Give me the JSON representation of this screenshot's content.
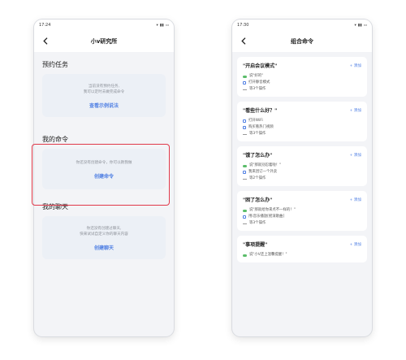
{
  "left": {
    "status_time": "17:24",
    "title": "小v研究所",
    "sections": [
      {
        "title": "预约任务",
        "lines": [
          "当前没有预约任务,",
          "我可以定时去做完成命令"
        ],
        "link": "查看示例说法"
      },
      {
        "title": "我的命令",
        "lines": [
          "你还没有创建命令，你可以教我做"
        ],
        "link": "创建命令"
      },
      {
        "title": "我的聊天",
        "lines": [
          "你还没有创建过聊天,",
          "快来试试自定义你的聊天内容"
        ],
        "link": "创建聊天"
      }
    ]
  },
  "right": {
    "status_time": "17:30",
    "title": "组合命令",
    "add_label": "+ 添加",
    "cards": [
      {
        "title": "\"开启会议模式\"",
        "lines": [
          {
            "type": "voice",
            "text": "说\"好的\""
          },
          {
            "type": "app",
            "text": "打开静音模式"
          },
          {
            "type": "more",
            "text": "等3个操作"
          }
        ]
      },
      {
        "title": "\"看些什么好？\"",
        "lines": [
          {
            "type": "app",
            "text": "打开WiFi"
          },
          {
            "type": "app",
            "text": "购买看热门视频"
          },
          {
            "type": "more",
            "text": "等3个操作"
          }
        ]
      },
      {
        "title": "\"饿了怎么办\"",
        "lines": [
          {
            "type": "voice",
            "text": "说\"那就别忍着啦！\""
          },
          {
            "type": "app",
            "text": "我来团订一个外卖"
          },
          {
            "type": "more",
            "text": "等2个操作"
          }
        ]
      },
      {
        "title": "\"困了怎么办\"",
        "lines": [
          {
            "type": "voice",
            "text": "说\"那就给你来点不一样的！\""
          },
          {
            "type": "app",
            "text": "用i音乐播放[摇滚歌曲]"
          },
          {
            "type": "more",
            "text": "等3个操作"
          }
        ]
      },
      {
        "title": "\"事项提醒\"",
        "lines": [
          {
            "type": "voice",
            "text": "说\"小V还上温馨提醒！\""
          }
        ]
      }
    ]
  }
}
